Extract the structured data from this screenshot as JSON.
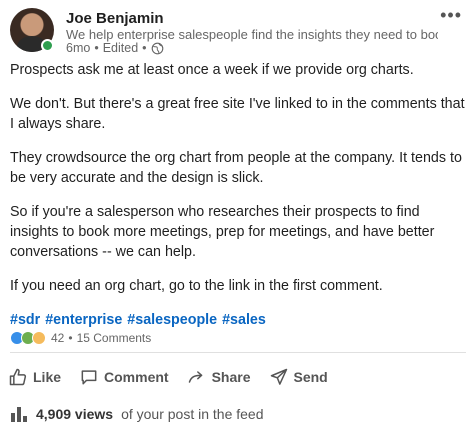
{
  "post": {
    "author": {
      "name": "Joe Benjamin",
      "headline": "We help enterprise salespeople find the insights they need to book more...",
      "time": "6mo",
      "edited": "Edited",
      "separator": "•",
      "more_label": "•••"
    },
    "paragraphs": [
      "Prospects ask me at least once a week if we provide org charts.",
      "We don't. But there's a great free site I've linked to in the comments that I always share.",
      "They crowdsource the org chart from people at the company. It tends to be very accurate and the design is slick.",
      "So if you're a salesperson who researches their prospects to find insights to book more meetings, prep for meetings, and have better conversations -- we can help.",
      "If you need an org chart, go to the link in the first comment."
    ],
    "hashtags": [
      "#sdr",
      "#enterprise",
      "#salespeople",
      "#sales"
    ],
    "social": {
      "reactions": [
        "like",
        "celebrate",
        "insightful"
      ],
      "reaction_count": "42",
      "separator": "•",
      "comments": "15 Comments"
    },
    "actions": {
      "like": "Like",
      "comment": "Comment",
      "share": "Share",
      "send": "Send"
    },
    "views": {
      "count": "4,909 views",
      "suffix": "of your post in the feed"
    }
  },
  "colors": {
    "link": "#0a66c2",
    "presence": "#2e9e4f",
    "text_muted": "#666666"
  }
}
